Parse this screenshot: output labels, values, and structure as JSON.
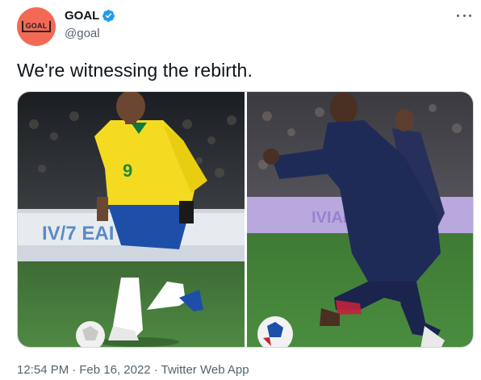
{
  "author": {
    "display_name": "GOAL",
    "handle": "@goal",
    "avatar_text": "GOAL",
    "verified": true,
    "avatar_color": "#f26a55",
    "verified_color": "#1d9bf0"
  },
  "tweet": {
    "text": "We're witnessing the rebirth."
  },
  "media": {
    "photos": [
      {
        "subject": "player-brazil-kit"
      },
      {
        "subject": "player-psg-kit"
      }
    ]
  },
  "meta": {
    "time": "12:54 PM",
    "date": "Feb 16, 2022",
    "separator": "·",
    "source": "Twitter Web App"
  },
  "icons": {
    "more": "more-horizontal-icon",
    "verified": "verified-badge-icon"
  }
}
